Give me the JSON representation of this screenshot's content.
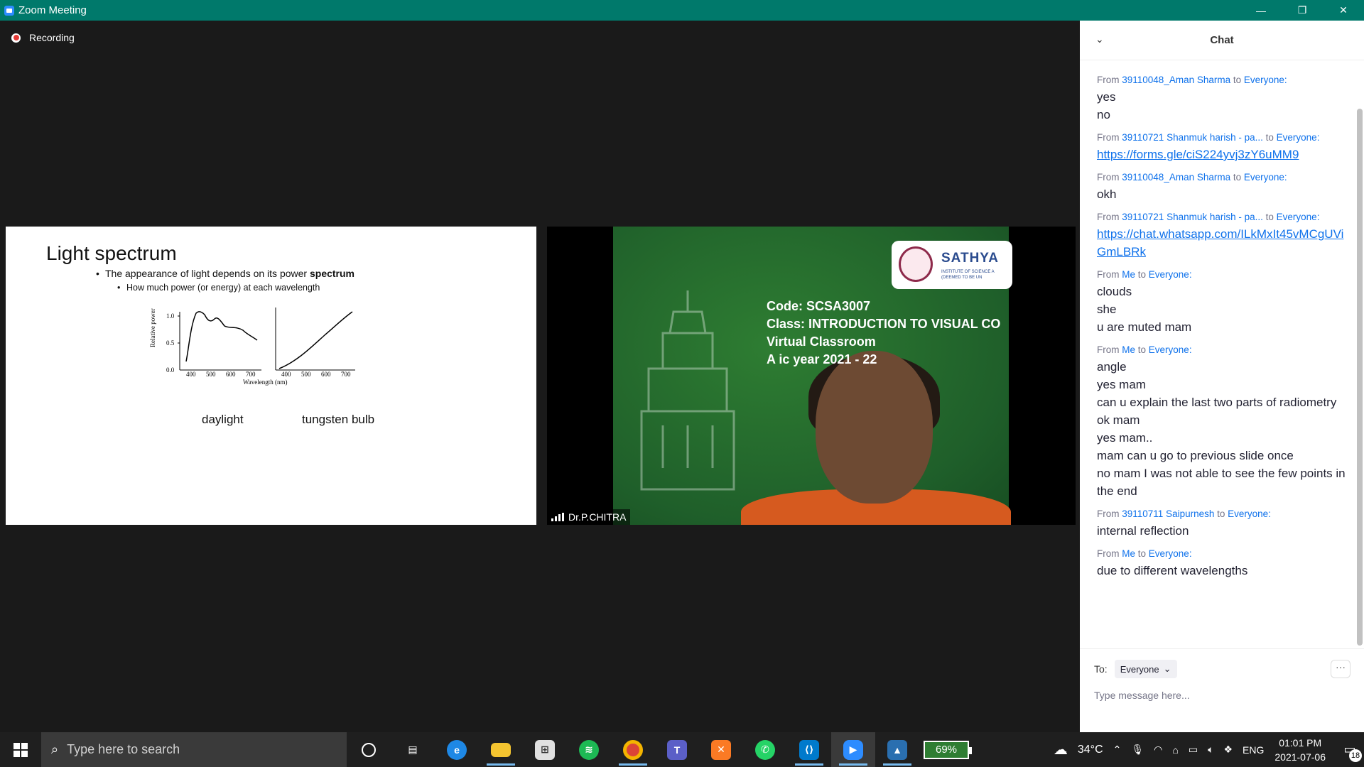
{
  "window": {
    "title": "Zoom Meeting",
    "controls": {
      "minimize": "—",
      "restore": "❐",
      "close": "✕"
    }
  },
  "recording": {
    "label": "Recording"
  },
  "slide": {
    "title": "Light spectrum",
    "bullet1_prefix": "The appearance of light depends on its power ",
    "bullet1_bold": "spectrum",
    "bullet2": "How much power (or energy) at each wavelength",
    "y_axis_label": "Relative power",
    "x_axis_label": "Wavelength (nm)",
    "y_ticks": [
      "1.0",
      "0.5",
      "0.0"
    ],
    "x_ticks": [
      "400",
      "500",
      "600",
      "700"
    ],
    "caption_left": "daylight",
    "caption_right": "tungsten bulb"
  },
  "video": {
    "participant_name": "Dr.P.CHITRA",
    "logo_text": "SATHYA",
    "logo_sub": "INSTITUTE OF SCIENCE A (DEEMED TO BE UN",
    "board_lines": [
      "Code: SCSA3007",
      "Class: INTRODUCTION TO VISUAL CO",
      "Virtual Classroom",
      "A      ic year 2021 - 22"
    ]
  },
  "chat": {
    "title": "Chat",
    "messages": [
      {
        "prefix": "From ",
        "sender": "39110048_Aman Sharma",
        "mid": " to ",
        "recipient": "Everyone:",
        "lines": [
          "yes",
          "no"
        ],
        "links": []
      },
      {
        "prefix": "From ",
        "sender": "39110721 Shanmuk harish  - pa...",
        "mid": " to ",
        "recipient": "Everyone:",
        "lines": [],
        "links": [
          "https://forms.gle/ciS224yvj3zY6uMM9"
        ]
      },
      {
        "prefix": "From ",
        "sender": "39110048_Aman Sharma",
        "mid": " to ",
        "recipient": "Everyone:",
        "lines": [
          "okh"
        ],
        "links": []
      },
      {
        "prefix": "From ",
        "sender": "39110721 Shanmuk harish  - pa...",
        "mid": " to ",
        "recipient": "Everyone:",
        "lines": [],
        "links": [
          "https://chat.whatsapp.com/ILkMxIt45vMCgUViGmLBRk"
        ]
      },
      {
        "prefix": "From ",
        "sender": "Me",
        "mid": " to ",
        "recipient": "Everyone:",
        "lines": [
          "clouds",
          "she",
          "u are muted mam"
        ],
        "links": []
      },
      {
        "prefix": "From ",
        "sender": "Me",
        "mid": " to ",
        "recipient": "Everyone:",
        "lines": [
          "angle",
          "yes mam",
          "can u explain the last two parts of radiometry",
          "ok mam",
          "yes mam..",
          "mam can u go to previous slide once",
          "no mam I was not able to see the few points in the end"
        ],
        "links": []
      },
      {
        "prefix": "From ",
        "sender": "39110711 Saipurnesh",
        "mid": " to ",
        "recipient": "Everyone:",
        "lines": [
          "internal reflection"
        ],
        "links": []
      },
      {
        "prefix": "From ",
        "sender": "Me",
        "mid": " to ",
        "recipient": "Everyone:",
        "lines": [
          "due to different wavelengths"
        ],
        "links": []
      }
    ],
    "to_label": "To:",
    "to_value": "Everyone",
    "more_label": "···",
    "input_placeholder": "Type message here..."
  },
  "taskbar": {
    "search_placeholder": "Type here to search",
    "battery_widget": "69%",
    "weather_temp": "34°C",
    "language": "ENG",
    "time": "01:01 PM",
    "date": "2021-07-06",
    "notification_count": "18"
  },
  "colors": {
    "titlebar": "#00796b",
    "chat_link": "#0e71eb",
    "board": "#2e7d32"
  }
}
